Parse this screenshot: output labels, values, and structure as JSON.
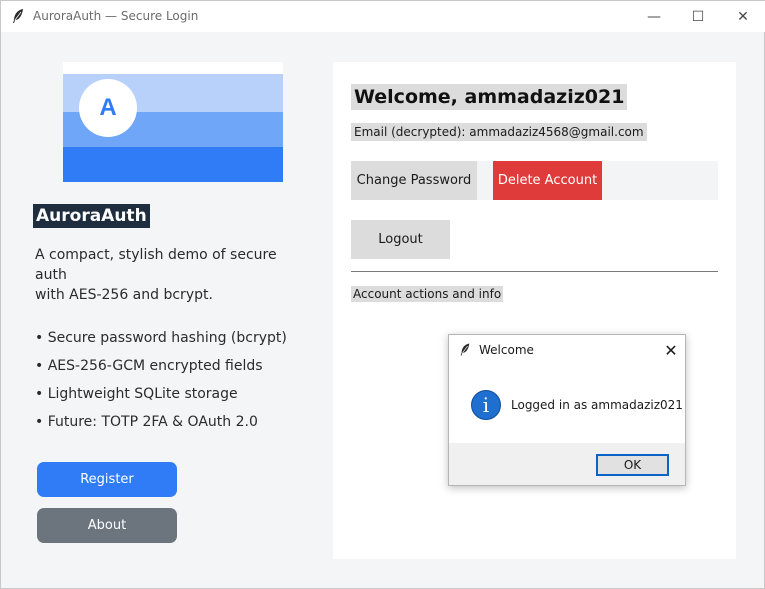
{
  "window": {
    "title": "AuroraAuth — Secure Login",
    "controls": {
      "minimize": "—",
      "maximize": "☐",
      "close": "✕"
    }
  },
  "left": {
    "logo_letter": "A",
    "brand": "AuroraAuth",
    "description_lines": [
      "A compact, stylish demo of secure",
      "auth",
      "with AES-256 and bcrypt."
    ],
    "features": [
      "• Secure password hashing (bcrypt)",
      "• AES-256-GCM encrypted fields",
      "• Lightweight SQLite storage",
      "• Future: TOTP 2FA & OAuth 2.0"
    ],
    "register_label": "Register",
    "about_label": "About"
  },
  "right": {
    "welcome": "Welcome, ammadaziz021",
    "email": "Email (decrypted): ammadaziz4568@gmail.com",
    "change_password_label": "Change Password",
    "delete_account_label": "Delete Account",
    "logout_label": "Logout",
    "info_label": "Account actions and info"
  },
  "dialog": {
    "title": "Welcome",
    "close": "✕",
    "icon_glyph": "i",
    "message": "Logged in as ammadaziz021",
    "ok_label": "OK"
  },
  "colors": {
    "accent": "#2f7cf6",
    "danger": "#e03b3b",
    "muted": "#6c757d",
    "brand_bg": "#1f2e3f"
  }
}
